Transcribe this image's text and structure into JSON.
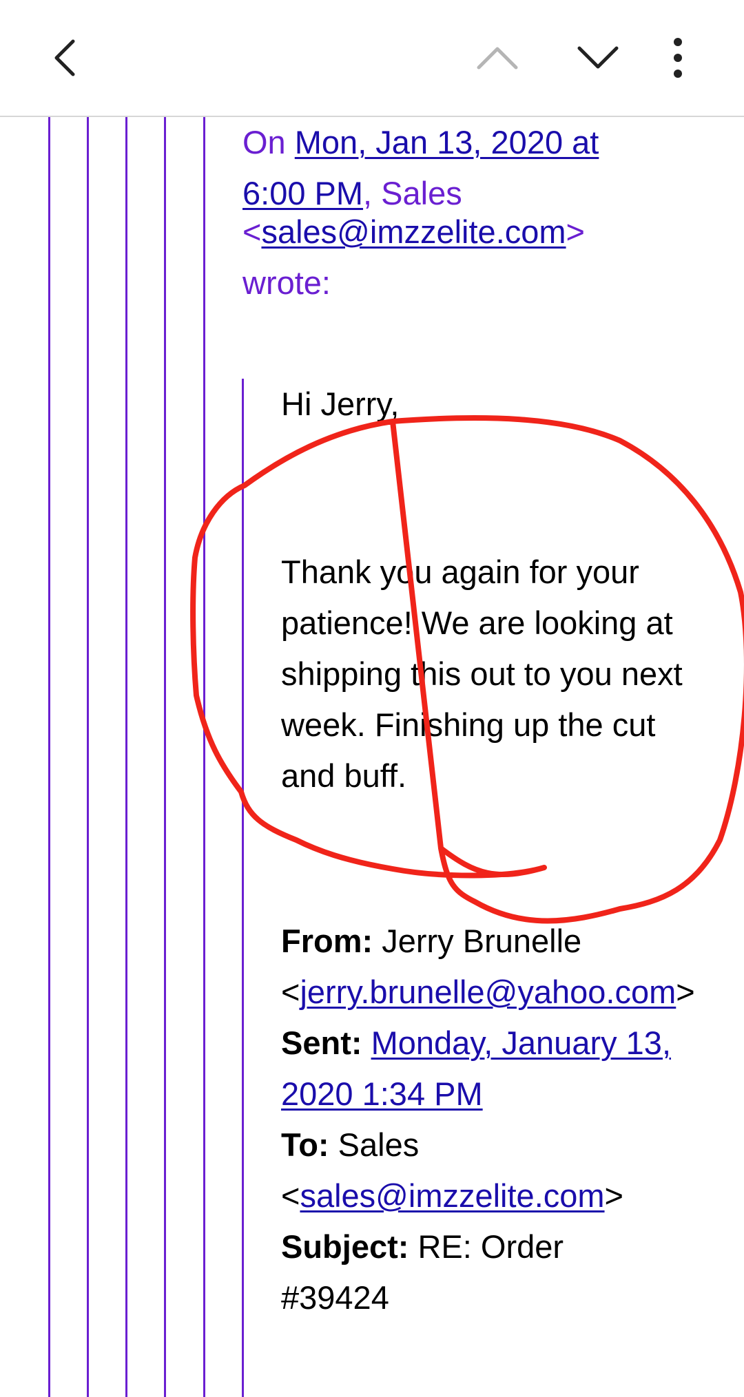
{
  "toolbar": {
    "back_icon": "chevron-left-icon",
    "prev_icon": "chevron-up-icon",
    "next_icon": "chevron-down-icon",
    "more_icon": "more-vertical-icon"
  },
  "quote": {
    "on_prefix": "On ",
    "date_link": "Mon, Jan 13, 2020 at 6:00 PM",
    "sender_sep": ", Sales",
    "lt": "<",
    "sender_email": "sales@imzzelite.com",
    "gt": ">",
    "wrote": "wrote:"
  },
  "message": {
    "greeting": "Hi Jerry,",
    "body": "Thank you again for your patience! We are looking at shipping this out to you next week. Finishing up the cut and buff."
  },
  "header": {
    "from_label": "From:",
    "from_name": "Jerry Brunelle",
    "from_lt": "<",
    "from_email": "jerry.brunelle@yahoo.com",
    "from_gt": ">",
    "sent_label": "Sent:",
    "sent_value": "Monday, January 13, 2020 1:34 PM",
    "to_label": "To:",
    "to_name": "Sales",
    "to_lt": "<",
    "to_email": "sales@imzzelite.com",
    "to_gt": ">",
    "subject_label": "Subject:",
    "subject_value": "RE: Order #39424"
  },
  "colors": {
    "quote_line": "#6a1fd1",
    "link": "#1a0dab",
    "annotation": "#f0241a"
  }
}
